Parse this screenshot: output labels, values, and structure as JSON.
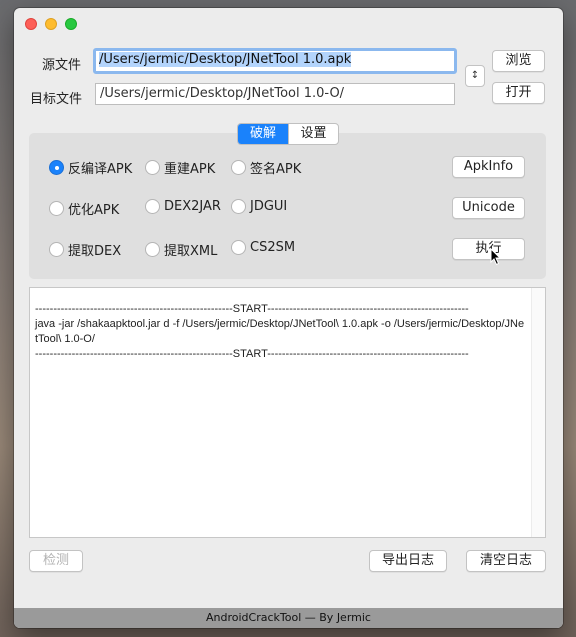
{
  "window": {
    "source_label": "源文件",
    "source_value": "/Users/jermic/Desktop/JNetTool 1.0.apk",
    "target_label": "目标文件",
    "target_value": "/Users/jermic/Desktop/JNetTool 1.0-O/",
    "browse_label": "浏览",
    "open_label": "打开",
    "stepper_icon": "↕"
  },
  "tabs": [
    {
      "label": "破解",
      "active": true
    },
    {
      "label": "设置",
      "active": false
    }
  ],
  "options": {
    "row1": [
      "反编译APK",
      "重建APK",
      "签名APK"
    ],
    "row2": [
      "优化APK",
      "DEX2JAR",
      "JDGUI"
    ],
    "row3": [
      "提取DEX",
      "提取XML",
      "CS2SM"
    ],
    "selected": "反编译APK"
  },
  "actions": {
    "apkinfo": "ApkInfo",
    "unicode": "Unicode",
    "execute": "执行"
  },
  "log": {
    "text": "------------------------------------------------------START-------------------------------------------------------\njava -jar /shakaapktool.jar d -f /Users/jermic/Desktop/JNetTool\\ 1.0.apk -o /Users/jermic/Desktop/JNetTool\\ 1.0-O/\n------------------------------------------------------START-------------------------------------------------------"
  },
  "bottom": {
    "detect_label": "检测",
    "export_log": "导出日志",
    "clear_log": "清空日志"
  },
  "footer": {
    "text": "AndroidCrackTool  —  By  Jermic"
  },
  "colors": {
    "accent": "#1a82fb",
    "focus_ring": "#8bb8ee",
    "selection": "#b3d4fc"
  }
}
